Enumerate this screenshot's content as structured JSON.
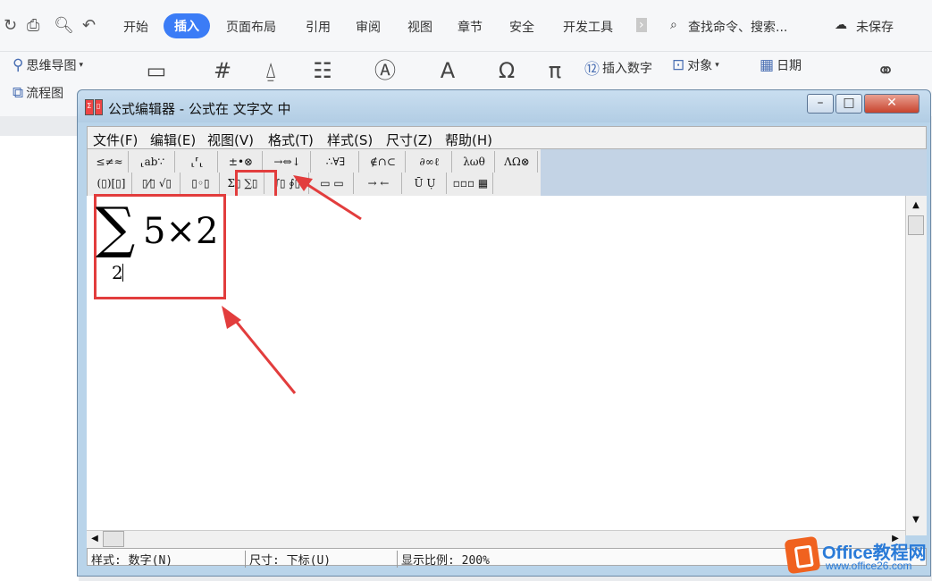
{
  "ribbon": {
    "tabs": [
      "开始",
      "插入",
      "页面布局",
      "引用",
      "审阅",
      "视图",
      "章节",
      "安全",
      "开发工具"
    ],
    "active_tab": "插入",
    "search": "查找命令、搜索...",
    "save_status": "未保存",
    "items": {
      "mindmap": "思维导图",
      "flowchart": "流程图",
      "insert_number": "插入数字",
      "object": "对象",
      "date": "日期"
    }
  },
  "window": {
    "title": "公式编辑器 - 公式在 文字文 中",
    "menus": [
      "文件(F)",
      "编辑(E)",
      "视图(V)",
      "格式(T)",
      "样式(S)",
      "尺寸(Z)",
      "帮助(H)"
    ],
    "toolbar_row1": [
      "≤≠≈",
      "⸤ab∵",
      "⸤⸢⸤",
      "±•⊗",
      "→⇔↓",
      "∴∀∃",
      "∉∩⊂",
      "∂∞ℓ",
      "λωθ",
      "ΛΩ⊗"
    ],
    "toolbar_row2": [
      "(▯)[▯]",
      "▯⁄▯ √▯",
      "▯◦▯",
      "Σ▯ ∑▯",
      "∫▯ ∮▯",
      "▭ ▭",
      "→ ←",
      "Ū Ụ",
      "▫▫▫ ▦"
    ]
  },
  "formula": {
    "operator": "∑",
    "expression": "5×2",
    "subscript": "2"
  },
  "statusbar": {
    "style": "样式: 数字(N)",
    "size": "尺寸: 下标(U)",
    "zoom": "显示比例: 200%"
  },
  "watermark": {
    "brand": "Office教程网",
    "url": "www.office26.com"
  },
  "colors": {
    "accent": "#3b7cf6",
    "highlight": "#e23d3d",
    "watermark": "#2a7bd8"
  }
}
